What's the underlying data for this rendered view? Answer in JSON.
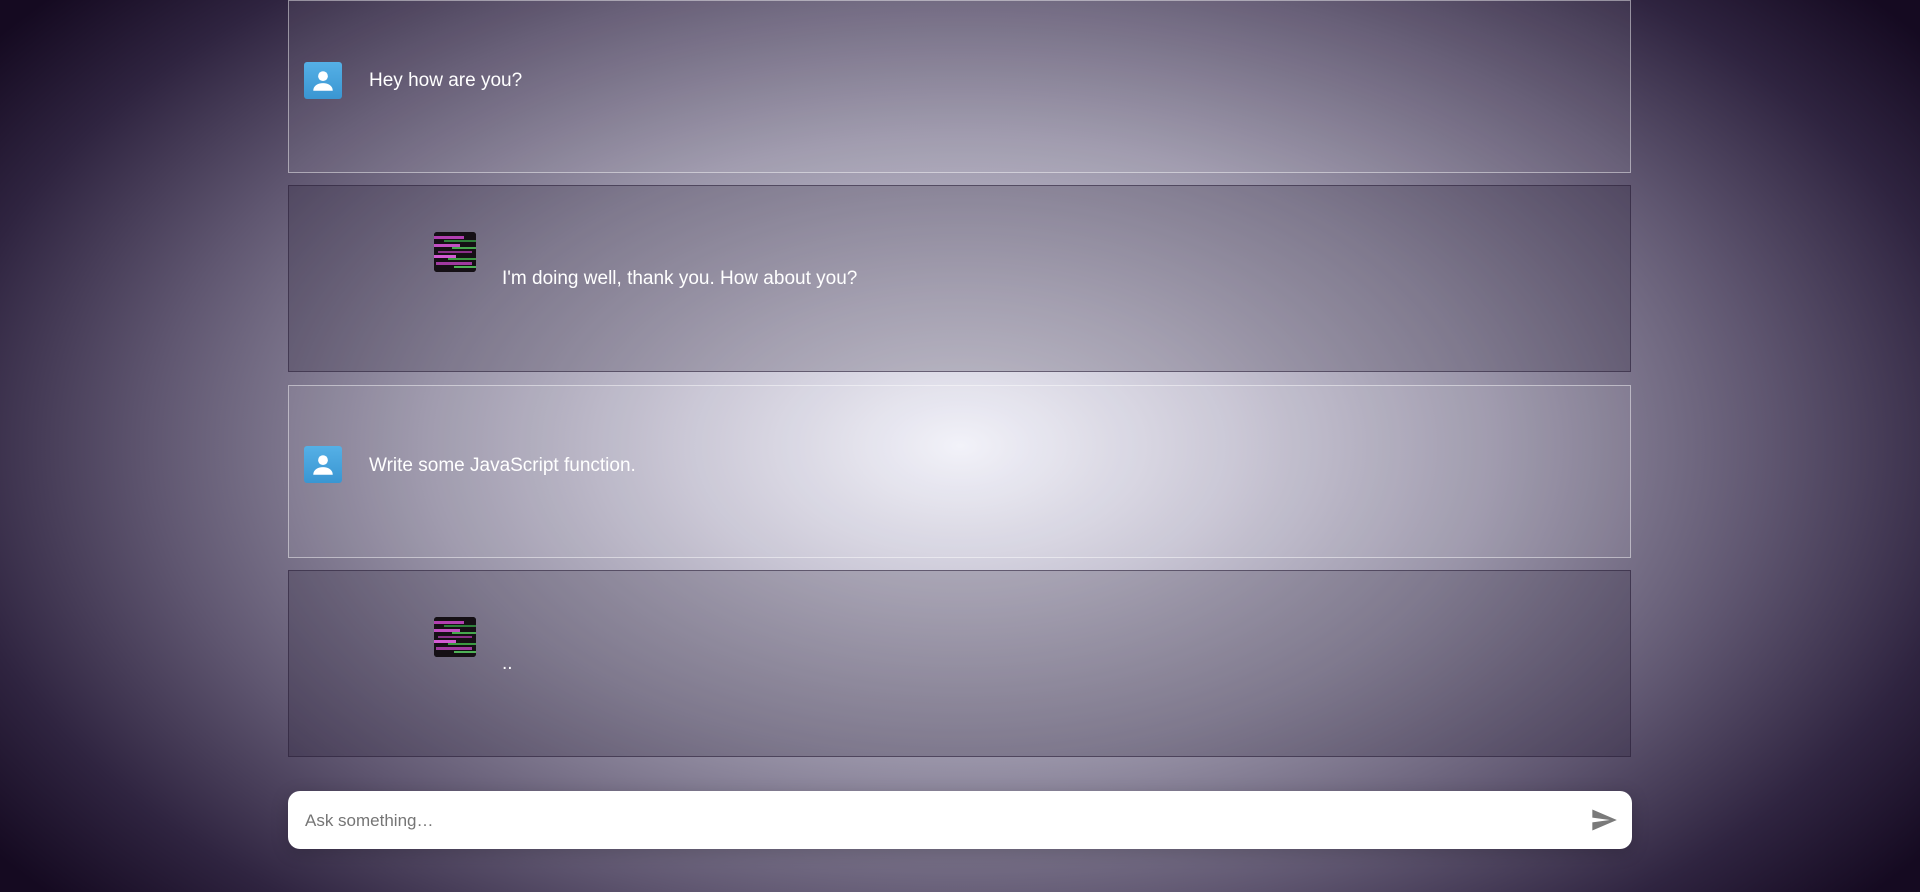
{
  "messages": [
    {
      "role": "user",
      "text": "Hey how are you?"
    },
    {
      "role": "assistant",
      "text": "I'm doing well, thank you. How about you?"
    },
    {
      "role": "user",
      "text": "Write some JavaScript function."
    },
    {
      "role": "assistant",
      "text": ".."
    }
  ],
  "input": {
    "placeholder": "Ask something…",
    "value": ""
  },
  "icons": {
    "user_avatar": "person-icon",
    "assistant_avatar": "glitch-avatar-icon",
    "send": "send-icon"
  },
  "colors": {
    "user_avatar_bg": "#4aa6df",
    "send_icon": "#7a7a7a"
  }
}
